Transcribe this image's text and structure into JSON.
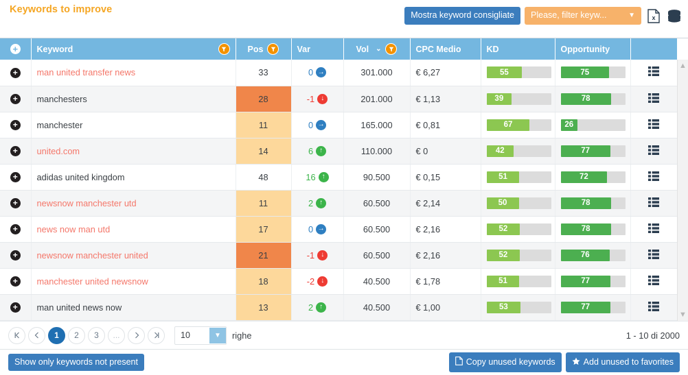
{
  "header": {
    "title": "Keywords to improve",
    "suggest_button": "Mostra keyword consigliate",
    "filter_select": "Please, filter keyw...",
    "filter_caret": "▼",
    "excel_icon": "excel-export-icon",
    "database_icon": "database-icon"
  },
  "table": {
    "columns": [
      {
        "key": "plus",
        "label": ""
      },
      {
        "key": "keyword",
        "label": "Keyword"
      },
      {
        "key": "pos",
        "label": "Pos"
      },
      {
        "key": "var",
        "label": "Var"
      },
      {
        "key": "vol",
        "label": "Vol"
      },
      {
        "key": "cpc",
        "label": "CPC Medio"
      },
      {
        "key": "kd",
        "label": "KD"
      },
      {
        "key": "opp",
        "label": "Opportunity"
      },
      {
        "key": "actions",
        "label": ""
      }
    ],
    "sort": {
      "column": "Vol",
      "caret": "⌄"
    },
    "rows": [
      {
        "keyword": "man united transfer news",
        "is_link": true,
        "pos": "33",
        "pos_level": "none",
        "var": "0",
        "var_dir": "flat",
        "vol": "301.000",
        "cpc": "€ 6,27",
        "kd": 55,
        "opportunity": 75
      },
      {
        "keyword": "manchesters",
        "is_link": false,
        "pos": "28",
        "pos_level": "high",
        "var": "-1",
        "var_dir": "down",
        "vol": "201.000",
        "cpc": "€ 1,13",
        "kd": 39,
        "opportunity": 78
      },
      {
        "keyword": "manchester",
        "is_link": false,
        "pos": "11",
        "pos_level": "mid",
        "var": "0",
        "var_dir": "flat",
        "vol": "165.000",
        "cpc": "€ 0,81",
        "kd": 67,
        "opportunity": 26
      },
      {
        "keyword": "united.com",
        "is_link": true,
        "pos": "14",
        "pos_level": "mid",
        "var": "6",
        "var_dir": "up",
        "vol": "110.000",
        "cpc": "€ 0",
        "kd": 42,
        "opportunity": 77
      },
      {
        "keyword": "adidas united kingdom",
        "is_link": false,
        "pos": "48",
        "pos_level": "none",
        "var": "16",
        "var_dir": "up",
        "vol": "90.500",
        "cpc": "€ 0,15",
        "kd": 51,
        "opportunity": 72
      },
      {
        "keyword": "newsnow manchester utd",
        "is_link": true,
        "pos": "11",
        "pos_level": "mid",
        "var": "2",
        "var_dir": "up",
        "vol": "60.500",
        "cpc": "€ 2,14",
        "kd": 50,
        "opportunity": 78
      },
      {
        "keyword": "news now man utd",
        "is_link": true,
        "pos": "17",
        "pos_level": "mid",
        "var": "0",
        "var_dir": "flat",
        "vol": "60.500",
        "cpc": "€ 2,16",
        "kd": 52,
        "opportunity": 78
      },
      {
        "keyword": "newsnow manchester united",
        "is_link": true,
        "pos": "21",
        "pos_level": "high",
        "var": "-1",
        "var_dir": "down",
        "vol": "60.500",
        "cpc": "€ 2,16",
        "kd": 52,
        "opportunity": 76
      },
      {
        "keyword": "manchester united newsnow",
        "is_link": true,
        "pos": "18",
        "pos_level": "mid",
        "var": "-2",
        "var_dir": "down",
        "vol": "40.500",
        "cpc": "€ 1,78",
        "kd": 51,
        "opportunity": 77
      },
      {
        "keyword": "man united news now",
        "is_link": false,
        "pos": "13",
        "pos_level": "mid",
        "var": "2",
        "var_dir": "up",
        "vol": "40.500",
        "cpc": "€ 1,00",
        "kd": 53,
        "opportunity": 77
      }
    ]
  },
  "pagination": {
    "first": "⧏|",
    "prev": "‹",
    "pages": [
      "1",
      "2",
      "3"
    ],
    "ellipsis": "...",
    "next": "›",
    "last": "|⧐",
    "active_page": "1",
    "rows_per_page": "10",
    "rows_label": "righe",
    "count_label": "1 - 10 di 2000"
  },
  "footer": {
    "show_not_present": "Show only keywords not present",
    "copy_unused": "Copy unused keywords",
    "add_favorites": "Add unused to favorites",
    "copy_icon": "copy-document-icon",
    "star_icon": "star-icon"
  }
}
